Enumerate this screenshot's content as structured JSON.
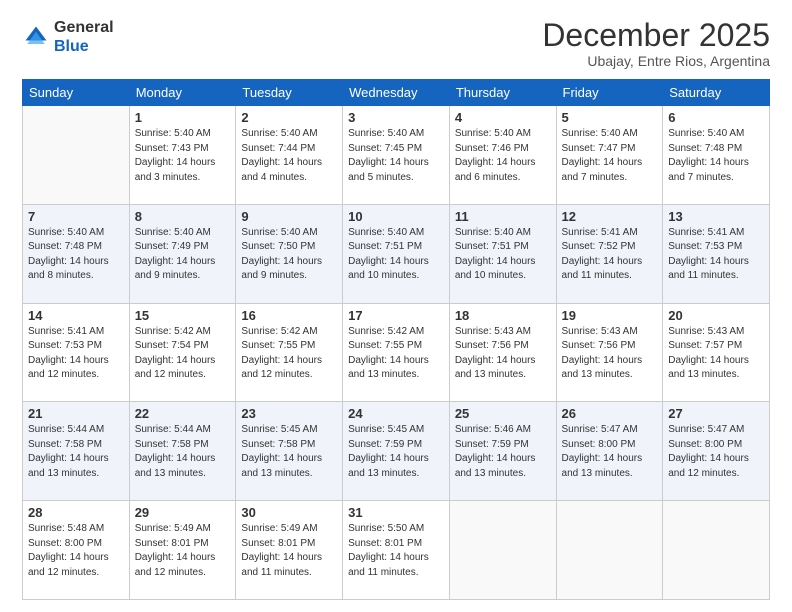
{
  "logo": {
    "general": "General",
    "blue": "Blue"
  },
  "header": {
    "month": "December 2025",
    "location": "Ubajay, Entre Rios, Argentina"
  },
  "weekdays": [
    "Sunday",
    "Monday",
    "Tuesday",
    "Wednesday",
    "Thursday",
    "Friday",
    "Saturday"
  ],
  "weeks": [
    [
      {
        "day": "",
        "info": ""
      },
      {
        "day": "1",
        "info": "Sunrise: 5:40 AM\nSunset: 7:43 PM\nDaylight: 14 hours\nand 3 minutes."
      },
      {
        "day": "2",
        "info": "Sunrise: 5:40 AM\nSunset: 7:44 PM\nDaylight: 14 hours\nand 4 minutes."
      },
      {
        "day": "3",
        "info": "Sunrise: 5:40 AM\nSunset: 7:45 PM\nDaylight: 14 hours\nand 5 minutes."
      },
      {
        "day": "4",
        "info": "Sunrise: 5:40 AM\nSunset: 7:46 PM\nDaylight: 14 hours\nand 6 minutes."
      },
      {
        "day": "5",
        "info": "Sunrise: 5:40 AM\nSunset: 7:47 PM\nDaylight: 14 hours\nand 7 minutes."
      },
      {
        "day": "6",
        "info": "Sunrise: 5:40 AM\nSunset: 7:48 PM\nDaylight: 14 hours\nand 7 minutes."
      }
    ],
    [
      {
        "day": "7",
        "info": "Sunrise: 5:40 AM\nSunset: 7:48 PM\nDaylight: 14 hours\nand 8 minutes."
      },
      {
        "day": "8",
        "info": "Sunrise: 5:40 AM\nSunset: 7:49 PM\nDaylight: 14 hours\nand 9 minutes."
      },
      {
        "day": "9",
        "info": "Sunrise: 5:40 AM\nSunset: 7:50 PM\nDaylight: 14 hours\nand 9 minutes."
      },
      {
        "day": "10",
        "info": "Sunrise: 5:40 AM\nSunset: 7:51 PM\nDaylight: 14 hours\nand 10 minutes."
      },
      {
        "day": "11",
        "info": "Sunrise: 5:40 AM\nSunset: 7:51 PM\nDaylight: 14 hours\nand 10 minutes."
      },
      {
        "day": "12",
        "info": "Sunrise: 5:41 AM\nSunset: 7:52 PM\nDaylight: 14 hours\nand 11 minutes."
      },
      {
        "day": "13",
        "info": "Sunrise: 5:41 AM\nSunset: 7:53 PM\nDaylight: 14 hours\nand 11 minutes."
      }
    ],
    [
      {
        "day": "14",
        "info": "Sunrise: 5:41 AM\nSunset: 7:53 PM\nDaylight: 14 hours\nand 12 minutes."
      },
      {
        "day": "15",
        "info": "Sunrise: 5:42 AM\nSunset: 7:54 PM\nDaylight: 14 hours\nand 12 minutes."
      },
      {
        "day": "16",
        "info": "Sunrise: 5:42 AM\nSunset: 7:55 PM\nDaylight: 14 hours\nand 12 minutes."
      },
      {
        "day": "17",
        "info": "Sunrise: 5:42 AM\nSunset: 7:55 PM\nDaylight: 14 hours\nand 13 minutes."
      },
      {
        "day": "18",
        "info": "Sunrise: 5:43 AM\nSunset: 7:56 PM\nDaylight: 14 hours\nand 13 minutes."
      },
      {
        "day": "19",
        "info": "Sunrise: 5:43 AM\nSunset: 7:56 PM\nDaylight: 14 hours\nand 13 minutes."
      },
      {
        "day": "20",
        "info": "Sunrise: 5:43 AM\nSunset: 7:57 PM\nDaylight: 14 hours\nand 13 minutes."
      }
    ],
    [
      {
        "day": "21",
        "info": "Sunrise: 5:44 AM\nSunset: 7:58 PM\nDaylight: 14 hours\nand 13 minutes."
      },
      {
        "day": "22",
        "info": "Sunrise: 5:44 AM\nSunset: 7:58 PM\nDaylight: 14 hours\nand 13 minutes."
      },
      {
        "day": "23",
        "info": "Sunrise: 5:45 AM\nSunset: 7:58 PM\nDaylight: 14 hours\nand 13 minutes."
      },
      {
        "day": "24",
        "info": "Sunrise: 5:45 AM\nSunset: 7:59 PM\nDaylight: 14 hours\nand 13 minutes."
      },
      {
        "day": "25",
        "info": "Sunrise: 5:46 AM\nSunset: 7:59 PM\nDaylight: 14 hours\nand 13 minutes."
      },
      {
        "day": "26",
        "info": "Sunrise: 5:47 AM\nSunset: 8:00 PM\nDaylight: 14 hours\nand 13 minutes."
      },
      {
        "day": "27",
        "info": "Sunrise: 5:47 AM\nSunset: 8:00 PM\nDaylight: 14 hours\nand 12 minutes."
      }
    ],
    [
      {
        "day": "28",
        "info": "Sunrise: 5:48 AM\nSunset: 8:00 PM\nDaylight: 14 hours\nand 12 minutes."
      },
      {
        "day": "29",
        "info": "Sunrise: 5:49 AM\nSunset: 8:01 PM\nDaylight: 14 hours\nand 12 minutes."
      },
      {
        "day": "30",
        "info": "Sunrise: 5:49 AM\nSunset: 8:01 PM\nDaylight: 14 hours\nand 11 minutes."
      },
      {
        "day": "31",
        "info": "Sunrise: 5:50 AM\nSunset: 8:01 PM\nDaylight: 14 hours\nand 11 minutes."
      },
      {
        "day": "",
        "info": ""
      },
      {
        "day": "",
        "info": ""
      },
      {
        "day": "",
        "info": ""
      }
    ]
  ]
}
